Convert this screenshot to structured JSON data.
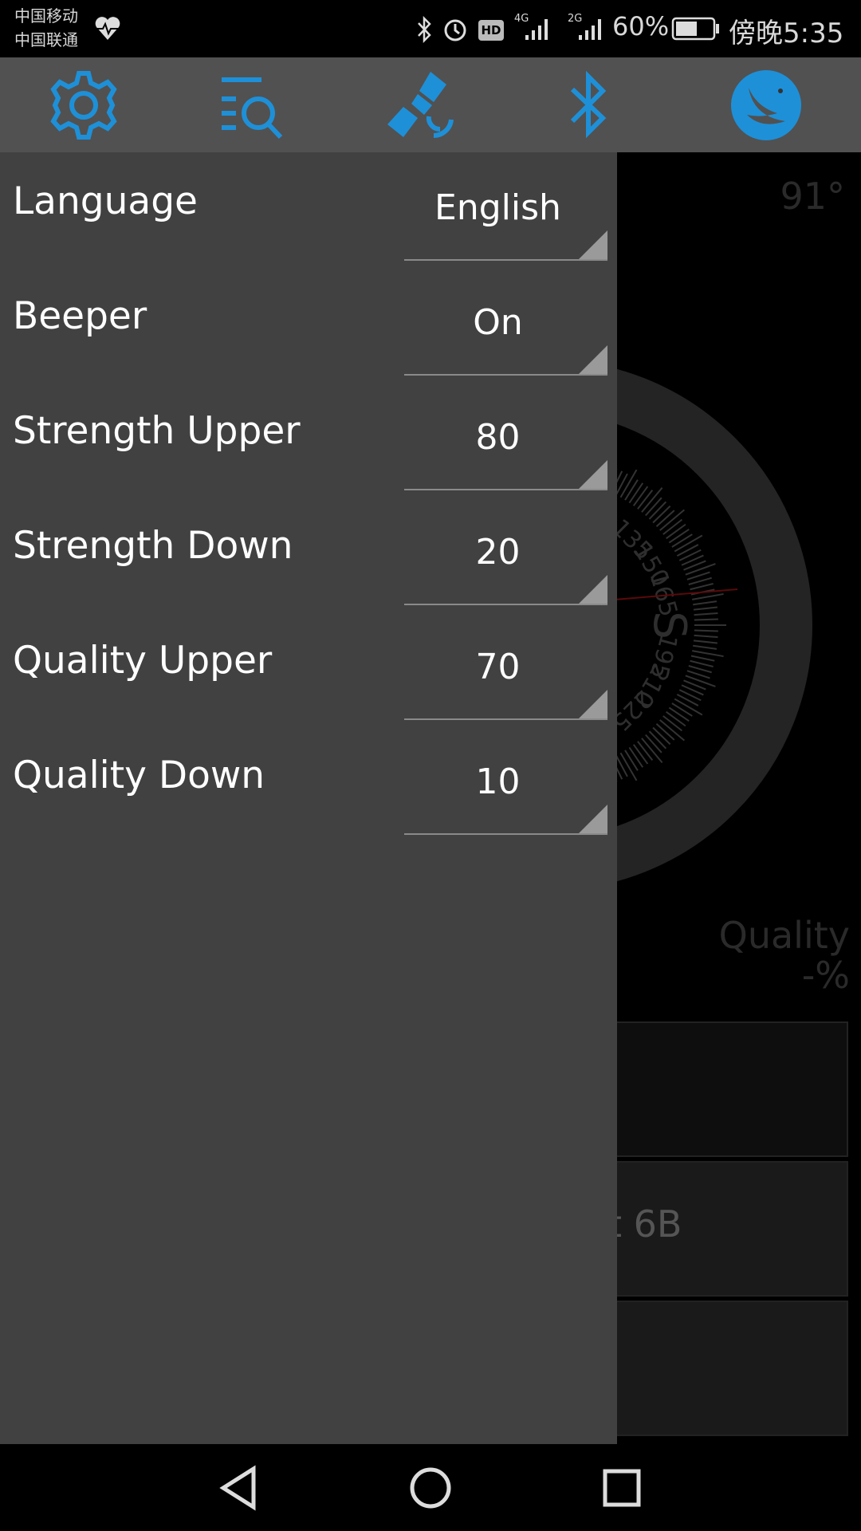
{
  "status_bar": {
    "carrier_1": "中国移动",
    "carrier_2": "中国联通",
    "network_1": "4G",
    "network_2": "2G",
    "battery": "60%",
    "time": "傍晚5:35",
    "icons": [
      "heart-rate-icon",
      "bluetooth-icon",
      "alarm-icon",
      "hd-icon",
      "signal-icon",
      "signal-icon",
      "battery-icon"
    ]
  },
  "toolbar": {
    "accent": "#1e90d8",
    "icons": [
      "settings-icon",
      "search-list-icon",
      "satellite-icon",
      "bluetooth-icon",
      "app-logo-icon"
    ]
  },
  "background": {
    "heading": "91°",
    "compass_labels": [
      "135",
      "150",
      "165",
      "S",
      "195",
      "210",
      "225"
    ],
    "quality_label": "Quality",
    "quality_value": "-%",
    "satellite_field": "t 6B"
  },
  "drawer": {
    "settings": [
      {
        "label": "Language",
        "value": "English"
      },
      {
        "label": "Beeper",
        "value": "On"
      },
      {
        "label": "Strength Upper",
        "value": "80"
      },
      {
        "label": "Strength Down",
        "value": "20"
      },
      {
        "label": "Quality Upper",
        "value": "70"
      },
      {
        "label": "Quality Down",
        "value": "10"
      }
    ]
  },
  "nav_bar": {
    "icons": [
      "back-icon",
      "home-icon",
      "recents-icon"
    ]
  }
}
